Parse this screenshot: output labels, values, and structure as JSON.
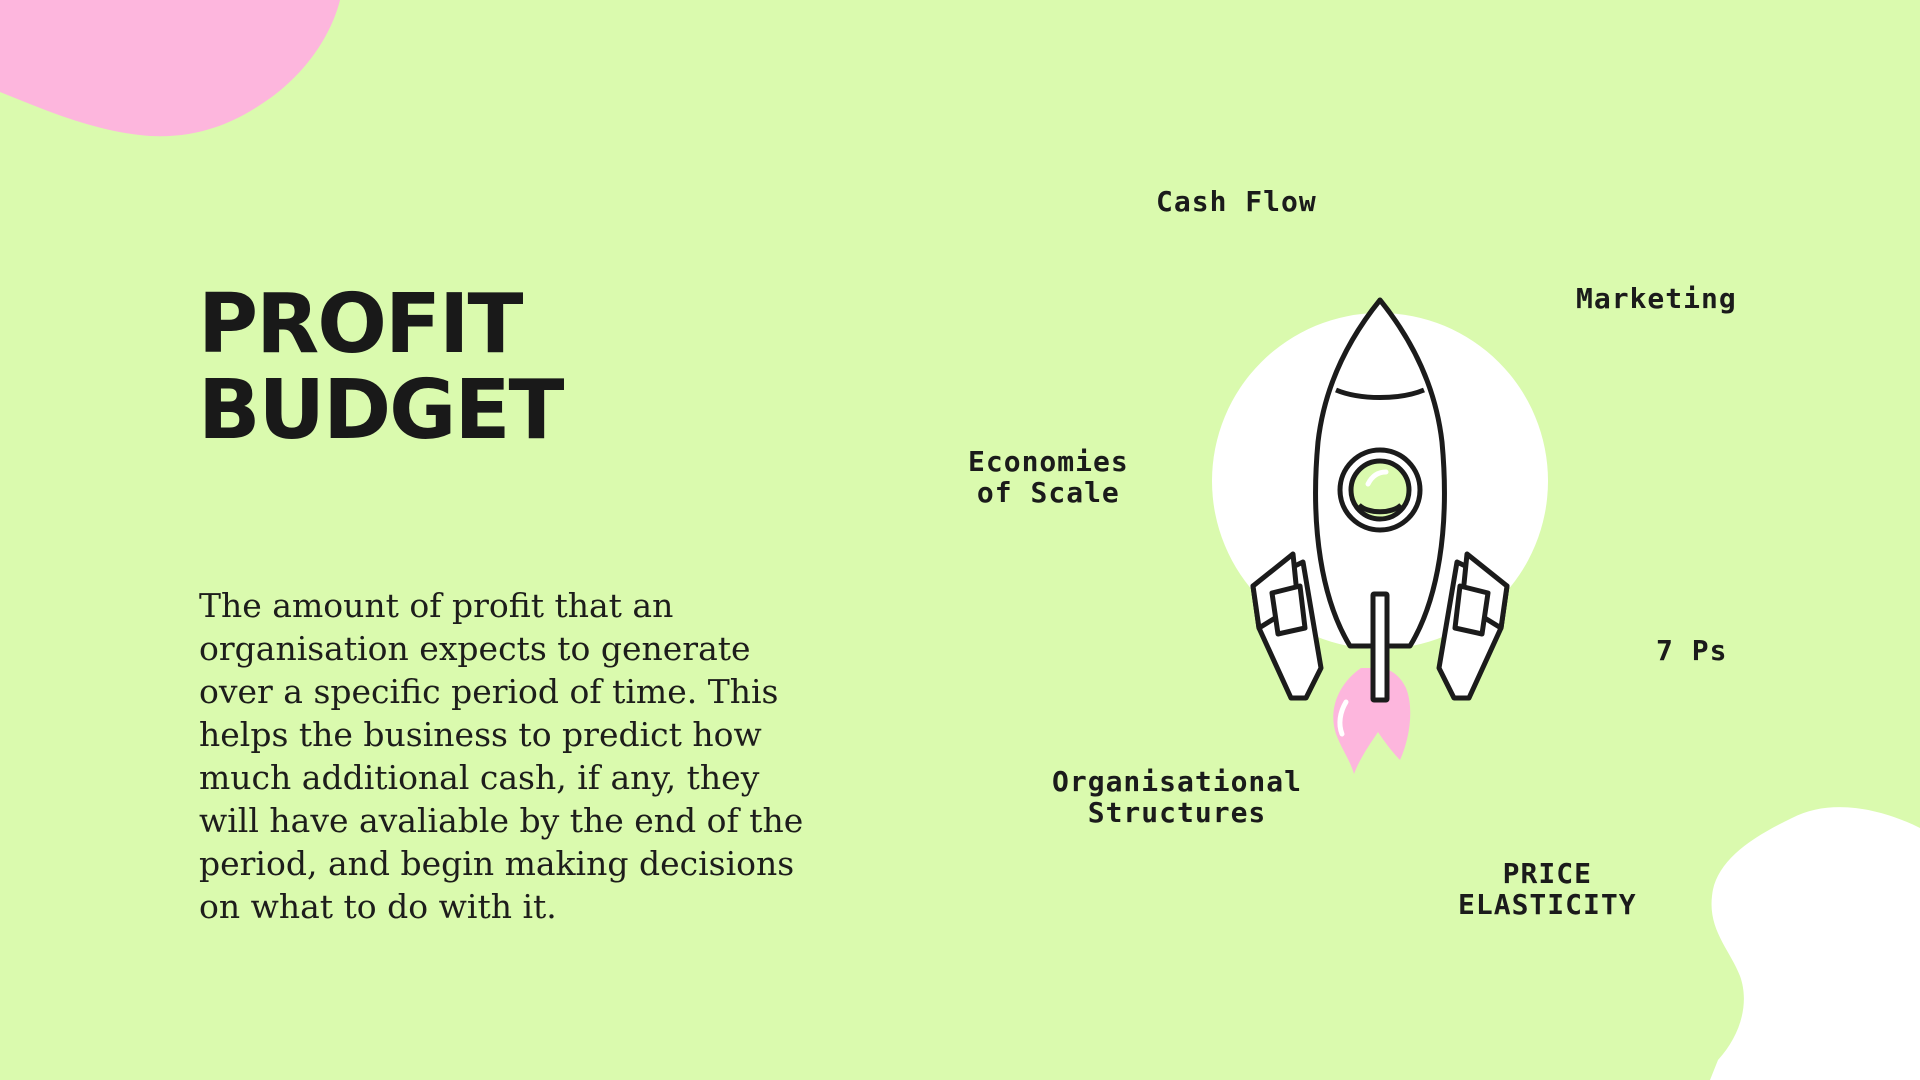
{
  "title": {
    "line1": "PROFIT",
    "line2": "BUDGET"
  },
  "body": "The amount of profit that an organisation expects to generate over a specific period of time. This helps the business to predict how much additional cash, if any, they will have avaliable by the end of the period, and begin making decisions on what to do with it.",
  "keywords": {
    "cash_flow": "Cash Flow",
    "marketing": "Marketing",
    "economies_line1": "Economies",
    "economies_line2": "of Scale",
    "seven_ps": "7 Ps",
    "org_line1": "Organisational",
    "org_line2": "Structures",
    "price_line1": "PRICE",
    "price_line2": "ELASTICITY"
  },
  "colors": {
    "background": "#dafaae",
    "accent_pink": "#fdb6dd",
    "white": "#ffffff",
    "ink": "#1b1b1b"
  },
  "illustration": {
    "icon": "rocket-icon"
  }
}
